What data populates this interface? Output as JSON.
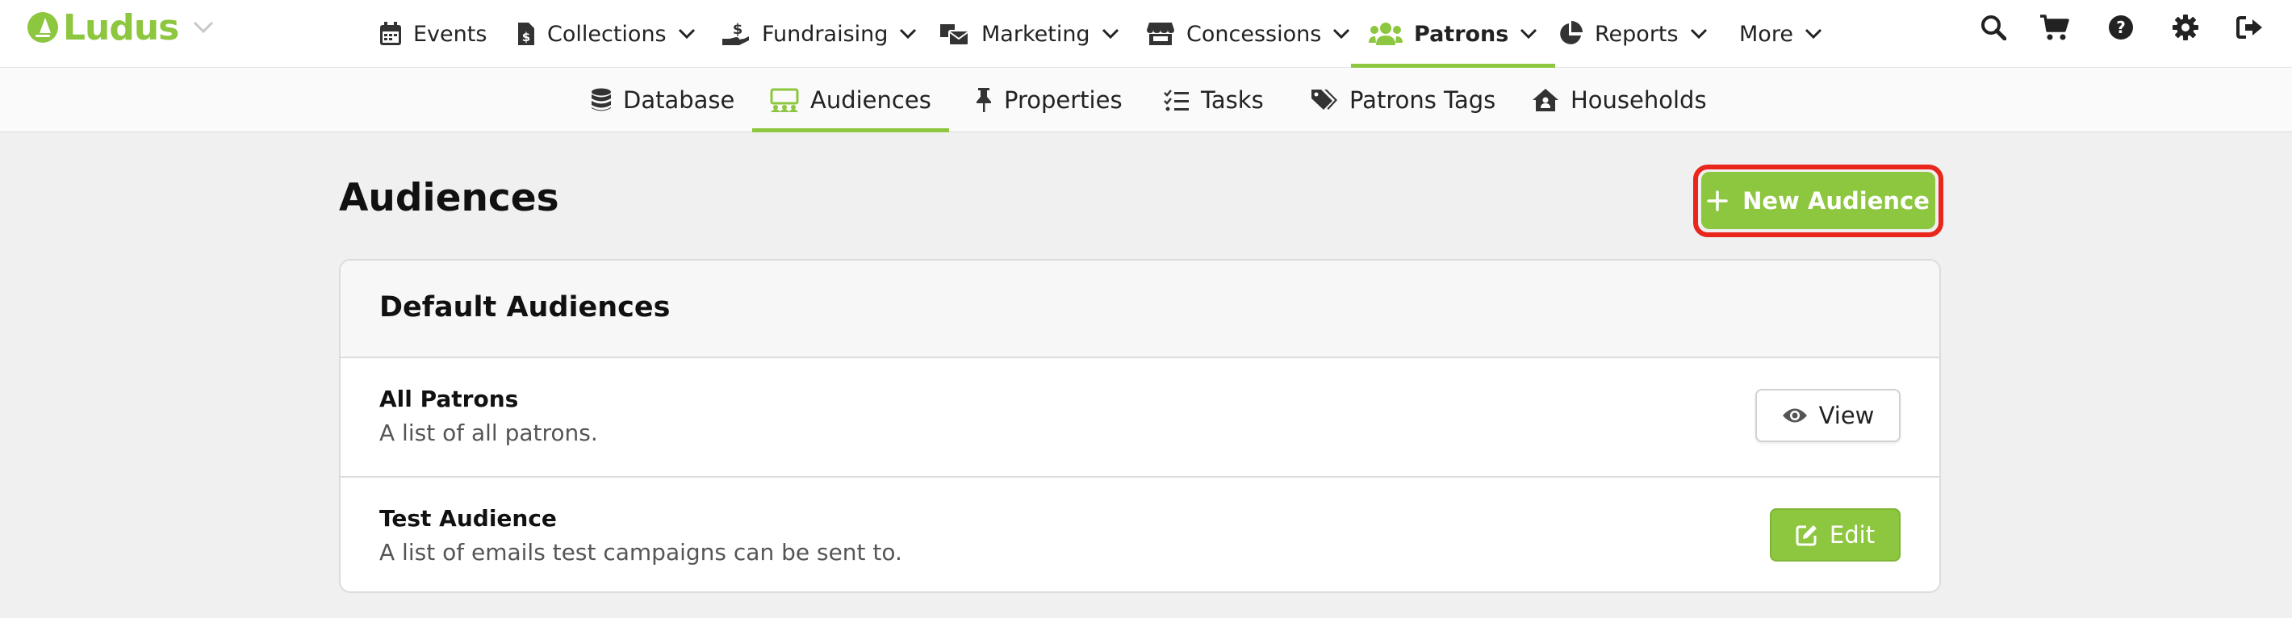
{
  "brand": {
    "name": "Ludus"
  },
  "nav": {
    "items": [
      {
        "label": "Events",
        "icon": "calendar-icon"
      },
      {
        "label": "Collections",
        "icon": "file-dollar-icon"
      },
      {
        "label": "Fundraising",
        "icon": "hand-dollar-icon"
      },
      {
        "label": "Marketing",
        "icon": "mail-bulk-icon"
      },
      {
        "label": "Concessions",
        "icon": "store-icon"
      },
      {
        "label": "Patrons",
        "icon": "users-icon",
        "active": true
      },
      {
        "label": "Reports",
        "icon": "pie-chart-icon"
      },
      {
        "label": "More"
      }
    ]
  },
  "right_icons": [
    "search-icon",
    "cart-icon",
    "help-icon",
    "gear-icon",
    "sign-out-icon"
  ],
  "subnav": {
    "items": [
      {
        "label": "Database",
        "icon": "database-icon"
      },
      {
        "label": "Audiences",
        "icon": "audience-icon",
        "active": true
      },
      {
        "label": "Properties",
        "icon": "thumbtack-icon"
      },
      {
        "label": "Tasks",
        "icon": "task-list-icon"
      },
      {
        "label": "Patrons Tags",
        "icon": "tags-icon"
      },
      {
        "label": "Households",
        "icon": "house-user-icon"
      }
    ]
  },
  "page": {
    "title": "Audiences",
    "new_button": "New Audience"
  },
  "card": {
    "title": "Default Audiences",
    "rows": [
      {
        "name": "All Patrons",
        "description": "A list of all patrons.",
        "action": "View"
      },
      {
        "name": "Test Audience",
        "description": "A list of emails test campaigns can be sent to.",
        "action": "Edit"
      }
    ]
  },
  "colors": {
    "accent": "#8dc63f",
    "highlight": "#e8261c"
  }
}
